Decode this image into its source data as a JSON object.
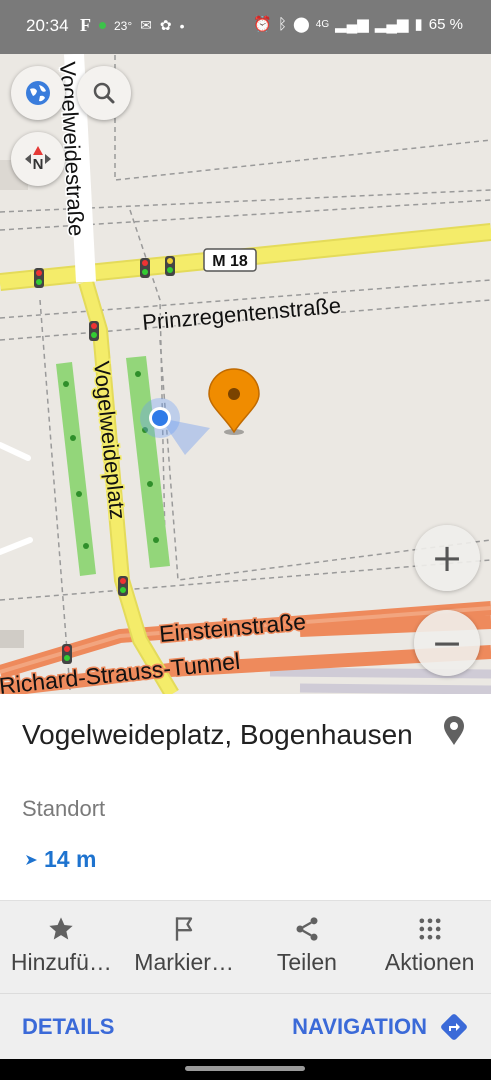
{
  "status_bar": {
    "time": "20:34",
    "left_icons": [
      "F",
      "23°"
    ],
    "network": "4G",
    "battery": "65 %"
  },
  "map": {
    "street_labels": {
      "vogelweidestrasse": "Vogelweidestraße",
      "prinzregentenstrasse": "Prinzregentenstraße",
      "vogelweideplatz": "Vogelweideplatz",
      "einsteinstrasse": "Einsteinstraße",
      "tunnel": "Richard-Strauss-Tunnel"
    },
    "route_badge": "M 18",
    "compass_letter": "N",
    "zoom_in": "+",
    "zoom_out": "−"
  },
  "place": {
    "title": "Vogelweideplatz, Bogenhausen",
    "subtitle": "Standort",
    "distance": "14 m"
  },
  "actions": [
    {
      "label": "Hinzufü…",
      "icon": "star-icon"
    },
    {
      "label": "Markier…",
      "icon": "flag-icon"
    },
    {
      "label": "Teilen",
      "icon": "share-icon"
    },
    {
      "label": "Aktionen",
      "icon": "more-grid-icon"
    }
  ],
  "bottom": {
    "details": "DETAILS",
    "navigation": "NAVIGATION"
  },
  "colors": {
    "accent": "#3b6ad8",
    "distance": "#1e73cf",
    "marker": "#f08c00",
    "road_yellow": "#f4ec6a",
    "road_orange": "#ee8a5c"
  }
}
